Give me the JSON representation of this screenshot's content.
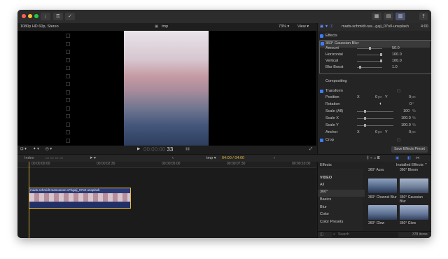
{
  "titlebar": {
    "icons": [
      "close-dot",
      "minimize-dot",
      "zoom-dot",
      "import-icon",
      "key-icon",
      "checkmark-icon",
      "grid-view-icon",
      "browser-icon",
      "inspector-icon",
      "share-icon"
    ]
  },
  "viewer": {
    "format": "1080p HD 60p, Stereo",
    "title": "tmp",
    "zoom": "73%",
    "view_label": "View",
    "timecode_dim": "00:00:00",
    "timecode_frame": "33"
  },
  "inspector": {
    "clip_name": "mads-schmidt-ras...gaji_07o0-unsplash",
    "duration": "4:00",
    "effects_header": "Effects",
    "effect_name": "360° Gaussian Blur",
    "params": [
      {
        "label": "Amount",
        "value": "50.0",
        "level": 0.5
      },
      {
        "label": "Horizontal",
        "value": "100.0",
        "level": 1.0
      },
      {
        "label": "Vertical",
        "value": "100.0",
        "level": 1.0
      },
      {
        "label": "Blur Boost",
        "value": "1.0",
        "level": 0.1
      }
    ],
    "compositing": "Compositing",
    "transform": "Transform",
    "position": {
      "label": "Position",
      "x_label": "X",
      "x": "0",
      "x_unit": "px",
      "y_label": "Y",
      "y": "0",
      "y_unit": "px"
    },
    "rotation": {
      "label": "Rotation",
      "value": "0",
      "unit": "°"
    },
    "scale_all": {
      "label": "Scale (All)",
      "value": "100",
      "unit": "%"
    },
    "scale_x": {
      "label": "Scale X",
      "value": "100.0",
      "unit": "%"
    },
    "scale_y": {
      "label": "Scale Y",
      "value": "100.0",
      "unit": "%"
    },
    "anchor": {
      "label": "Anchor",
      "x_label": "X",
      "x": "0",
      "x_unit": "px",
      "y_label": "Y",
      "y": "0",
      "y_unit": "px"
    },
    "crop": "Crop",
    "save_preset": "Save Effects Preset"
  },
  "timeline_bar": {
    "index_label": "Index",
    "project": "tmp",
    "time": "04:00 / 04:00"
  },
  "timeline": {
    "ruler": [
      "00:00:00:00",
      "00:00:02:30",
      "00:00:05:00",
      "00:00:07:30",
      "00:00:10:00"
    ],
    "clip_label": "mads-schmidt-rasmussen-vFbgaji_07o0-unsplash"
  },
  "effects_browser": {
    "header": "Effects",
    "installed": "Installed Effects",
    "categories": [
      "VIDEO",
      "All",
      "360°",
      "Basics",
      "Blur",
      "Color",
      "Color Presets"
    ],
    "effects": [
      {
        "top_label": "360° Aura",
        "name": ""
      },
      {
        "top_label": "360° Bloom",
        "name": ""
      },
      {
        "top_label": "",
        "name": "360° Channel Blur"
      },
      {
        "top_label": "",
        "name": "360° Gaussian Blur"
      },
      {
        "top_label": "",
        "name": "360° Glow"
      },
      {
        "top_label": "",
        "name": "360° Glow"
      }
    ],
    "search_placeholder": "Search",
    "count": "378 items"
  }
}
